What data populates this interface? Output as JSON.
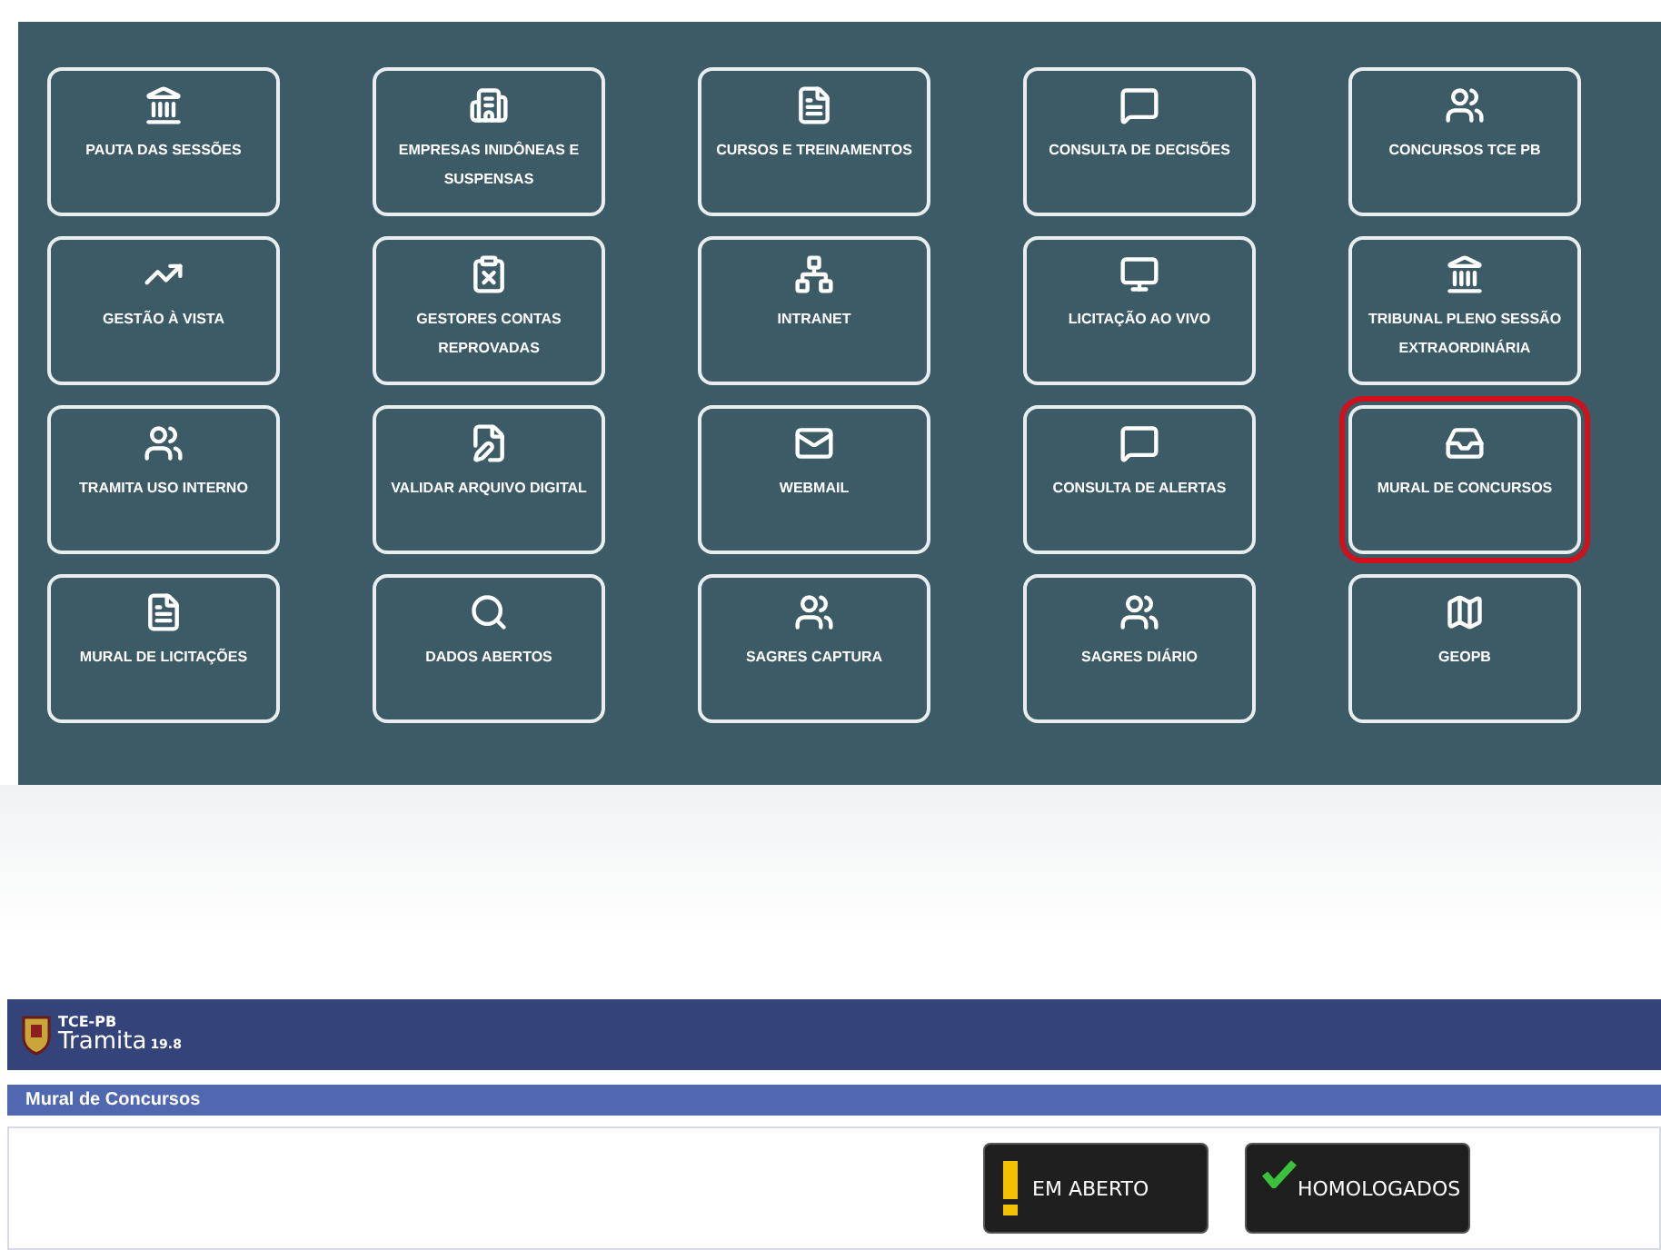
{
  "tiles": [
    {
      "label": "PAUTA DAS SESSÕES",
      "selected": false
    },
    {
      "label": "EMPRESAS INIDÔNEAS E SUSPENSAS",
      "selected": false
    },
    {
      "label": "CURSOS E TREINAMENTOS",
      "selected": false
    },
    {
      "label": "CONSULTA DE DECISÕES",
      "selected": false
    },
    {
      "label": "CONCURSOS TCE PB",
      "selected": false
    },
    {
      "label": "GESTÃO À VISTA",
      "selected": false
    },
    {
      "label": "GESTORES CONTAS REPROVADAS",
      "selected": false
    },
    {
      "label": "INTRANET",
      "selected": false
    },
    {
      "label": "LICITAÇÃO AO VIVO",
      "selected": false
    },
    {
      "label": "TRIBUNAL PLENO SESSÃO EXTRAORDINÁRIA",
      "selected": false
    },
    {
      "label": "TRAMITA USO INTERNO",
      "selected": false
    },
    {
      "label": "VALIDAR ARQUIVO DIGITAL",
      "selected": false
    },
    {
      "label": "WEBMAIL",
      "selected": false
    },
    {
      "label": "CONSULTA DE ALERTAS",
      "selected": false
    },
    {
      "label": "MURAL DE CONCURSOS",
      "selected": true
    },
    {
      "label": "MURAL DE LICITAÇÕES",
      "selected": false
    },
    {
      "label": "DADOS ABERTOS",
      "selected": false
    },
    {
      "label": "SAGRES CAPTURA",
      "selected": false
    },
    {
      "label": "SAGRES DIÁRIO",
      "selected": false
    },
    {
      "label": "GEOPB",
      "selected": false
    }
  ],
  "app_header": {
    "org": "TCE-PB",
    "name": "Tramita",
    "version": "19.8"
  },
  "section_title": "Mural de Concursos",
  "buttons": [
    {
      "label": "EM ABERTO",
      "kind": "warning"
    },
    {
      "label": "HOMOLOGADOS",
      "kind": "check"
    }
  ]
}
